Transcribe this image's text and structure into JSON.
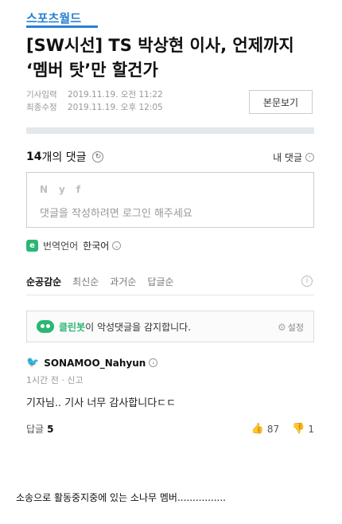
{
  "brand": {
    "logo_text": "스포츠월드"
  },
  "article": {
    "headline": "[SW시선] TS 박상현 이사, 언제까지 ‘멤버 탓’만 할건가",
    "meta": [
      {
        "label": "기사입력",
        "value": "2019.11.19. 오전 11:22"
      },
      {
        "label": "최종수정",
        "value": "2019.11.19. 오후 12:05"
      }
    ],
    "view_original_label": "본문보기"
  },
  "comments": {
    "count": "14",
    "count_suffix": "개의 댓글",
    "my_comments_label": "내 댓글",
    "sns": [
      "N",
      "y",
      "f"
    ],
    "input_placeholder": "댓글을 작성하려면 로그인 해주세요",
    "lang_label": "번역언어",
    "lang_value": "한국어",
    "sort_tabs": [
      "순공감순",
      "최신순",
      "과거순",
      "답글순"
    ],
    "active_sort_index": 0,
    "cleanbot": {
      "name": "클린봇",
      "message": "이 악성댓글을 감지합니다.",
      "settings_label": "설정"
    },
    "items": [
      {
        "user": "SONAMOO_Nahyun",
        "time": "1시간 전",
        "report": "신고",
        "text": "기자님.. 기사 너무 감사합니다ㄷㄷ",
        "reply_label": "답글",
        "reply_count": "5",
        "likes": "87",
        "dislikes": "1"
      }
    ]
  },
  "caption": "소송으로 활동중지중에 있는 소나무 멤버................",
  "colors": {
    "brand_blue": "#2a7fd4",
    "cleanbot_green": "#2bb673",
    "twitter_blue": "#1da1f2"
  }
}
